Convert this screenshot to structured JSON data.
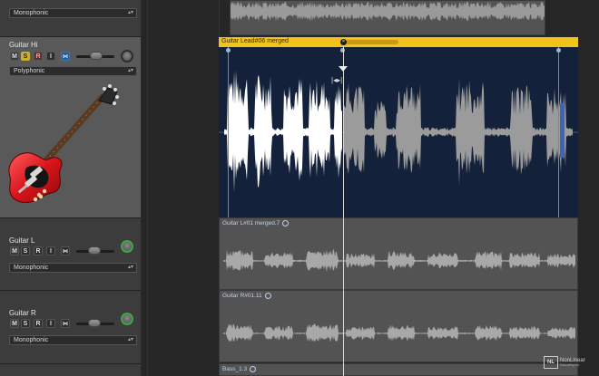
{
  "tracks": [
    {
      "name": "",
      "mode": "Monophonic"
    },
    {
      "name": "Guitar Hi",
      "mode": "Polyphonic",
      "buttons": [
        "M",
        "S",
        "R",
        "I"
      ]
    },
    {
      "name": "Guitar L",
      "mode": "Monophonic",
      "buttons": [
        "M",
        "S",
        "R",
        "I"
      ]
    },
    {
      "name": "Guitar R",
      "mode": "Monophonic",
      "buttons": [
        "M",
        "S",
        "R",
        "I"
      ]
    }
  ],
  "regions": {
    "selected": "Guitar Lead#06 merged",
    "guitar_l": "Guitar L#01 merged.7",
    "guitar_r": "Guitar R#01.11",
    "bass": "Bass_1.3"
  },
  "watermark": {
    "logo": "NL",
    "name": "NonLinear",
    "tagline": "Educating Inc."
  },
  "colors": {
    "region_selected": "#f2c31b",
    "solo": "#c9b033",
    "input_monitor": "#2a5a8a",
    "playhead": "#d8d8d8"
  }
}
